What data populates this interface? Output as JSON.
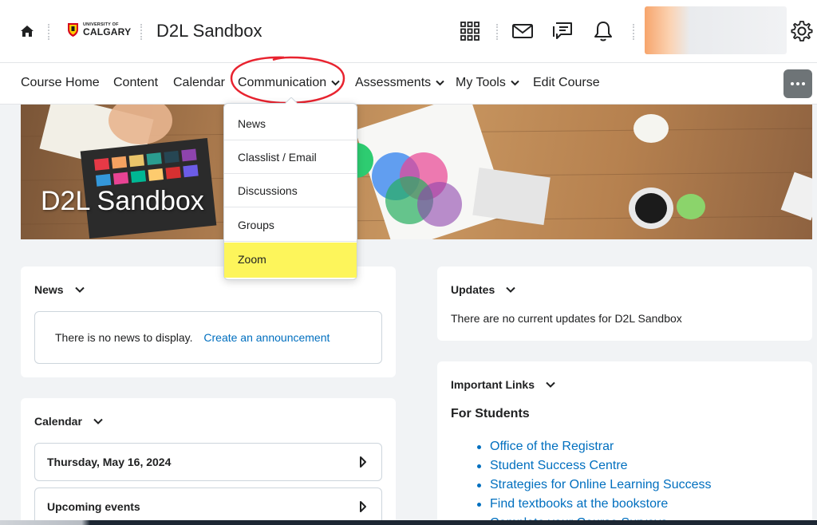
{
  "header": {
    "logo_top": "UNIVERSITY OF",
    "logo_bottom": "CALGARY",
    "org_title": "D2L Sandbox"
  },
  "nav": {
    "items": [
      {
        "label": "Course Home"
      },
      {
        "label": "Content"
      },
      {
        "label": "Calendar"
      },
      {
        "label": "Communication",
        "has_dropdown": true,
        "open": true
      },
      {
        "label": "Assessments",
        "has_dropdown": true
      },
      {
        "label": "My Tools",
        "has_dropdown": true
      },
      {
        "label": "Edit Course"
      }
    ]
  },
  "dropdown": {
    "items": [
      {
        "label": "News"
      },
      {
        "label": "Classlist / Email"
      },
      {
        "label": "Discussions"
      },
      {
        "label": "Groups"
      },
      {
        "label": "Zoom",
        "highlighted": true
      }
    ],
    "highlight_color": "#fdf55b"
  },
  "banner": {
    "title": "D2L Sandbox"
  },
  "news": {
    "title": "News",
    "empty_text": "There is no news to display.",
    "create_link": "Create an announcement"
  },
  "calendar": {
    "title": "Calendar",
    "date": "Thursday, May 16, 2024",
    "upcoming": "Upcoming events"
  },
  "updates": {
    "title": "Updates",
    "text": "There are no current updates for D2L Sandbox"
  },
  "important_links": {
    "title": "Important Links",
    "subtitle": "For Students",
    "links": [
      "Office of the Registrar",
      "Student Success Centre",
      "Strategies for Online Learning Success",
      "Find textbooks at the bookstore",
      "Complete your Course Surveys"
    ]
  },
  "colors": {
    "link": "#006fbf",
    "annotation_circle": "#e8232f",
    "more_button": "#6e7477"
  },
  "icons": [
    "home-icon",
    "university-shield-icon",
    "apps-grid-icon",
    "mail-icon",
    "chat-icon",
    "bell-icon",
    "gear-icon",
    "chevron-down-icon",
    "more-options-icon",
    "chevron-right-icon"
  ]
}
